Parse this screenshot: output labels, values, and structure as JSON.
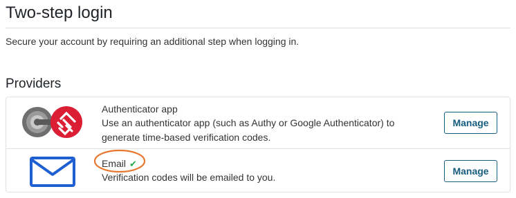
{
  "page": {
    "title": "Two-step login",
    "subtitle": "Secure your account by requiring an additional step when logging in."
  },
  "providers_section": {
    "heading": "Providers",
    "items": [
      {
        "name": "Authenticator app",
        "description": "Use an authenticator app (such as Authy or Google Authenticator) to generate time-based verification codes.",
        "button_label": "Manage",
        "icon": "authenticator-app-icon",
        "enabled": false
      },
      {
        "name": "Email",
        "description": "Verification codes will be emailed to you.",
        "button_label": "Manage",
        "icon": "envelope-icon",
        "enabled": true,
        "status_icon": "check-icon"
      }
    ]
  },
  "colors": {
    "primary": "#175d7f",
    "success": "#28a745",
    "border": "#dee2e6",
    "annotation": "#e8762e",
    "authy_red": "#dc1e35",
    "envelope_blue": "#1f5fd1"
  }
}
